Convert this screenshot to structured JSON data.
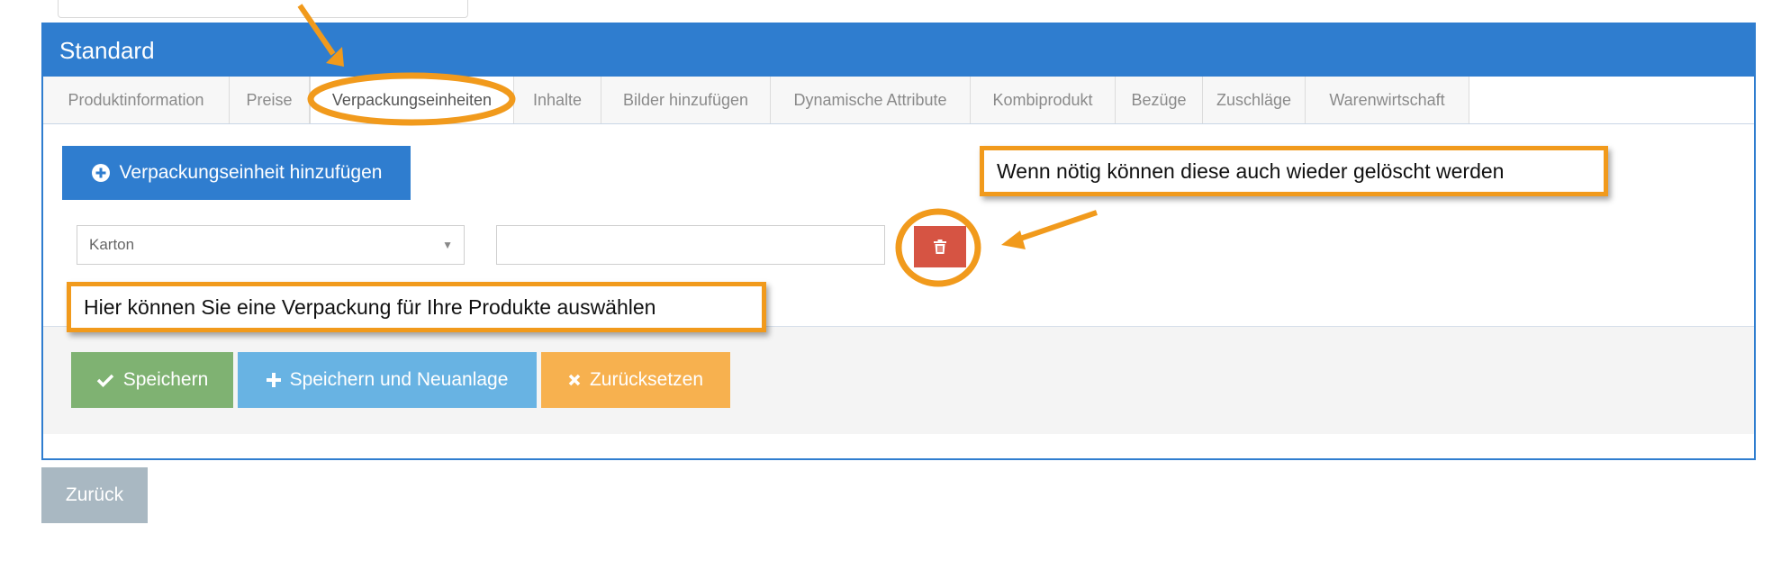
{
  "panel": {
    "title": "Standard",
    "tabs": [
      {
        "label": "Produktinformation"
      },
      {
        "label": "Preise"
      },
      {
        "label": "Verpackungseinheiten"
      },
      {
        "label": "Inhalte"
      },
      {
        "label": "Bilder hinzufügen"
      },
      {
        "label": "Dynamische Attribute"
      },
      {
        "label": "Kombiprodukt"
      },
      {
        "label": "Bezüge"
      },
      {
        "label": "Zuschläge"
      },
      {
        "label": "Warenwirtschaft"
      }
    ],
    "active_tab": "Verpackungseinheiten"
  },
  "packaging": {
    "add_label": "Verpackungseinheit hinzufügen",
    "select_value": "Karton",
    "text_value": ""
  },
  "actions": {
    "save_label": "Speichern",
    "save_new_label": "Speichern und Neuanlage",
    "reset_label": "Zurücksetzen",
    "back_label": "Zurück"
  },
  "annotations": {
    "delete_hint": "Wenn nötig können diese auch wieder gelöscht werden",
    "select_hint": "Hier können Sie eine Verpackung für Ihre Produkte auswählen"
  },
  "colors": {
    "primary": "#2f7dcf",
    "danger": "#d65443",
    "success": "#7fb272",
    "info": "#68b3e3",
    "warning": "#f7b14f",
    "default": "#a9b8c2",
    "annotation": "#f19a1c"
  }
}
